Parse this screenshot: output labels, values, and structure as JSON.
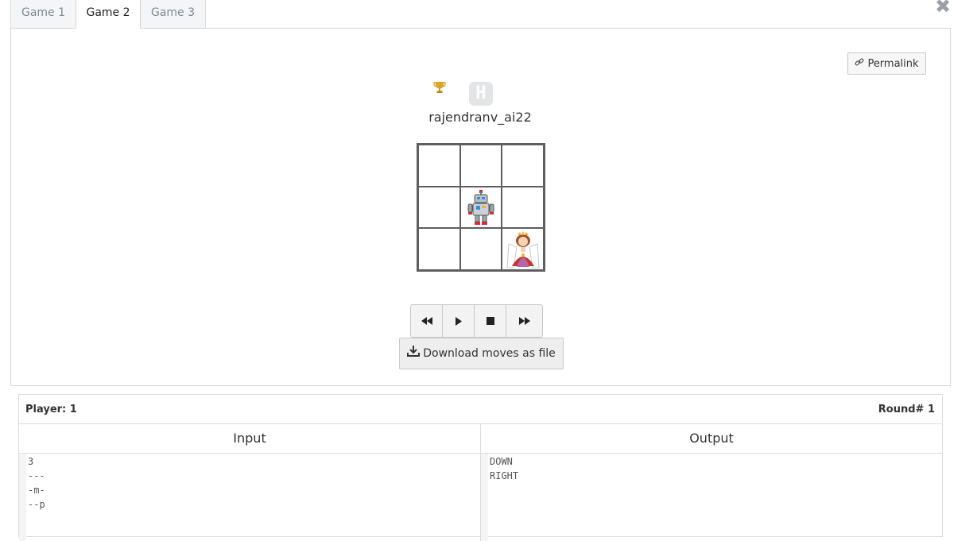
{
  "tabs": [
    {
      "label": "Game 1",
      "active": false
    },
    {
      "label": "Game 2",
      "active": true
    },
    {
      "label": "Game 3",
      "active": false
    }
  ],
  "close_icon": "✖",
  "permalink_label": "Permalink",
  "player_name": "rajendranv_ai22",
  "board": {
    "size": 3,
    "rows": [
      "---",
      "-m-",
      "--p"
    ],
    "bot_symbol": "m",
    "princess_symbol": "p"
  },
  "controls": [
    "rewind-icon",
    "play-icon",
    "stop-icon",
    "fast-forward-icon"
  ],
  "download_label": "Download moves as file",
  "io": {
    "player_label": "Player: 1",
    "round_label": "Round# 1",
    "input_header": "Input",
    "output_header": "Output",
    "input_text": "3\n---\n-m-\n--p",
    "output_text": "DOWN\nRIGHT"
  },
  "colors": {
    "trophy": "#c9951c",
    "board_border": "#5f5f5f"
  }
}
